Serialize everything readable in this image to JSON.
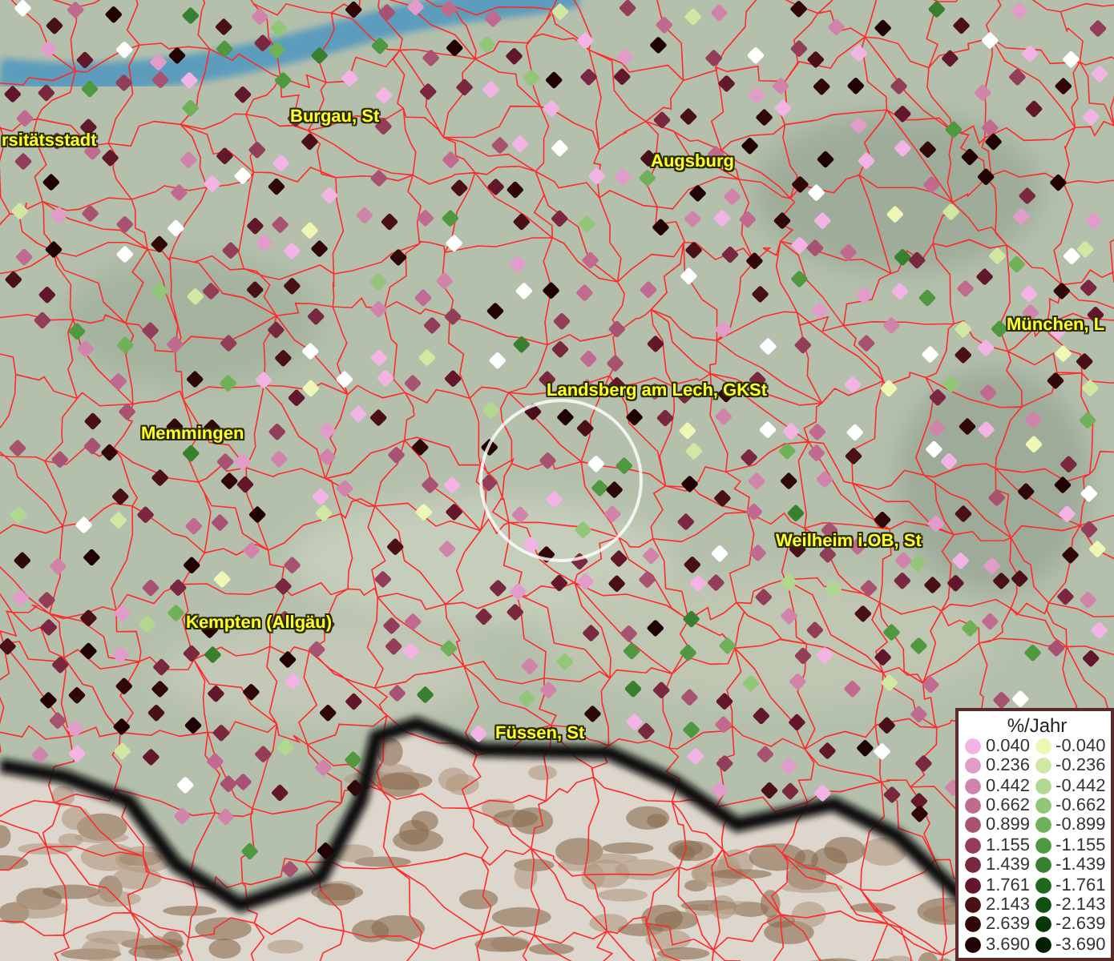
{
  "map": {
    "place_labels": [
      {
        "text": "rsitätsstadt"
      },
      {
        "text": "Burgau, St"
      },
      {
        "text": "Augsburg"
      },
      {
        "text": "München, L"
      },
      {
        "text": "Landsberg am Lech, GKSt"
      },
      {
        "text": "Memmingen"
      },
      {
        "text": "Weilheim i.OB, St"
      },
      {
        "text": "Kempten (Allgäu)"
      },
      {
        "text": "Füssen, St"
      }
    ]
  },
  "legend": {
    "title": "%/Jahr",
    "columns": [
      {
        "entries": [
          {
            "value": "0.040",
            "color": "#f2b4e4"
          },
          {
            "value": "0.236",
            "color": "#e29cca"
          },
          {
            "value": "0.442",
            "color": "#d084aa"
          },
          {
            "value": "0.662",
            "color": "#c06a90"
          },
          {
            "value": "0.899",
            "color": "#a85272"
          },
          {
            "value": "1.155",
            "color": "#923e58"
          },
          {
            "value": "1.439",
            "color": "#7a2840"
          },
          {
            "value": "1.761",
            "color": "#62182a"
          },
          {
            "value": "2.143",
            "color": "#4a1018"
          },
          {
            "value": "2.639",
            "color": "#30080a"
          },
          {
            "value": "3.690",
            "color": "#200204"
          }
        ]
      },
      {
        "entries": [
          {
            "value": "-0.040",
            "color": "#eef8b4"
          },
          {
            "value": "-0.236",
            "color": "#d2e8a2"
          },
          {
            "value": "-0.442",
            "color": "#b2d890"
          },
          {
            "value": "-0.662",
            "color": "#92c678"
          },
          {
            "value": "-0.899",
            "color": "#70b058"
          },
          {
            "value": "-1.155",
            "color": "#509840"
          },
          {
            "value": "-1.439",
            "color": "#388030"
          },
          {
            "value": "-1.761",
            "color": "#20681e"
          },
          {
            "value": "-2.143",
            "color": "#105010"
          },
          {
            "value": "-2.639",
            "color": "#083808"
          },
          {
            "value": "-3.690",
            "color": "#042004"
          }
        ]
      }
    ]
  }
}
